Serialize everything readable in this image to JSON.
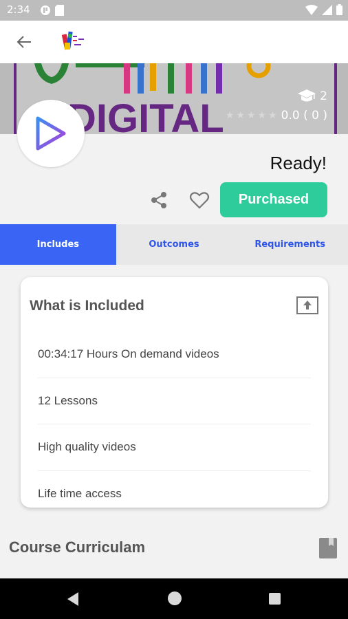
{
  "status_bar": {
    "time": "2:34"
  },
  "banner": {
    "enrolled_count": "2",
    "rating_text": "0.0 ( 0 )"
  },
  "course": {
    "title": "Ready!",
    "purchase_label": "Purchased"
  },
  "tabs": [
    {
      "label": "Includes",
      "active": true
    },
    {
      "label": "Outcomes",
      "active": false
    },
    {
      "label": "Requirements",
      "active": false
    }
  ],
  "includes_card": {
    "title": "What is Included",
    "items": [
      "00:34:17 Hours On demand videos",
      "12 Lessons",
      "High quality videos",
      "Life time access"
    ]
  },
  "curriculum": {
    "title": "Course Curriculam"
  },
  "colors": {
    "accent_green": "#2ecc9a",
    "tab_active": "#3a64f4",
    "tab_text": "#2f56e8"
  }
}
